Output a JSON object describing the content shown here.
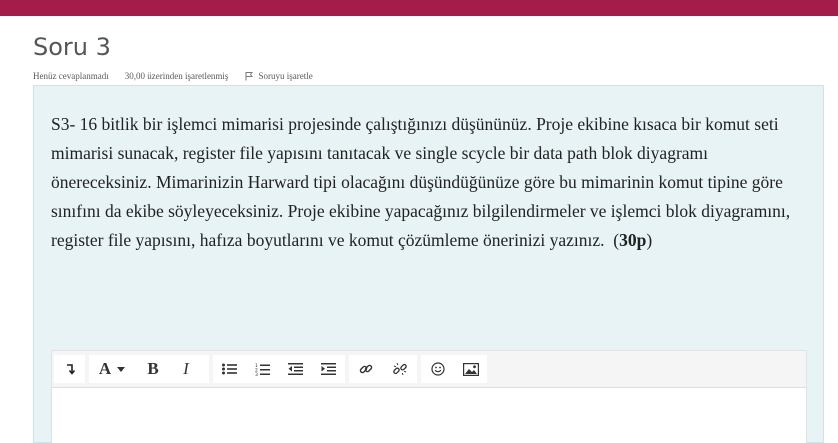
{
  "theme": {
    "accent": "#a41d4a",
    "question_bg": "#e7f3f5"
  },
  "question": {
    "title": "Soru 3",
    "status": "Henüz cevaplanmadı",
    "points": "30,00 üzerinden işaretlenmiş",
    "flag_label": "Soruyu işaretle",
    "flag_icon": "flag-icon",
    "text": "S3- 16 bitlik bir işlemci mimarisi projesinde çalıştığınızı düşününüz. Proje ekibine kısaca bir komut seti mimarisi sunacak, register file yapısını tanıtacak ve single scycle bir data path blok diyagramı önereceksiniz. Mimarinizin Harward tipi olacağını düşündüğünüze göre bu mimarinin komut tipine göre sınıfını da ekibe söyleyeceksiniz. Proje ekibine yapacağınız bilgilendirmeler ve işlemci blok diyagramını, register file yapısını, hafıza boyutlarını ve komut çözümleme önerinizi yazınız.",
    "score_open": "(",
    "score": "30p",
    "score_close": ")"
  },
  "editor": {
    "toolbar": {
      "collapse_icon": "collapse-toolbar-icon",
      "font_label": "A",
      "font_icon": "font-style-dropdown-icon",
      "bold_label": "B",
      "italic_label": "I",
      "unordered_list_icon": "unordered-list-icon",
      "ordered_list_icon": "ordered-list-icon",
      "outdent_icon": "outdent-icon",
      "indent_icon": "indent-icon",
      "link_icon": "link-icon",
      "unlink_icon": "unlink-icon",
      "emoji_icon": "emoji-icon",
      "image_icon": "image-icon"
    },
    "value": ""
  }
}
